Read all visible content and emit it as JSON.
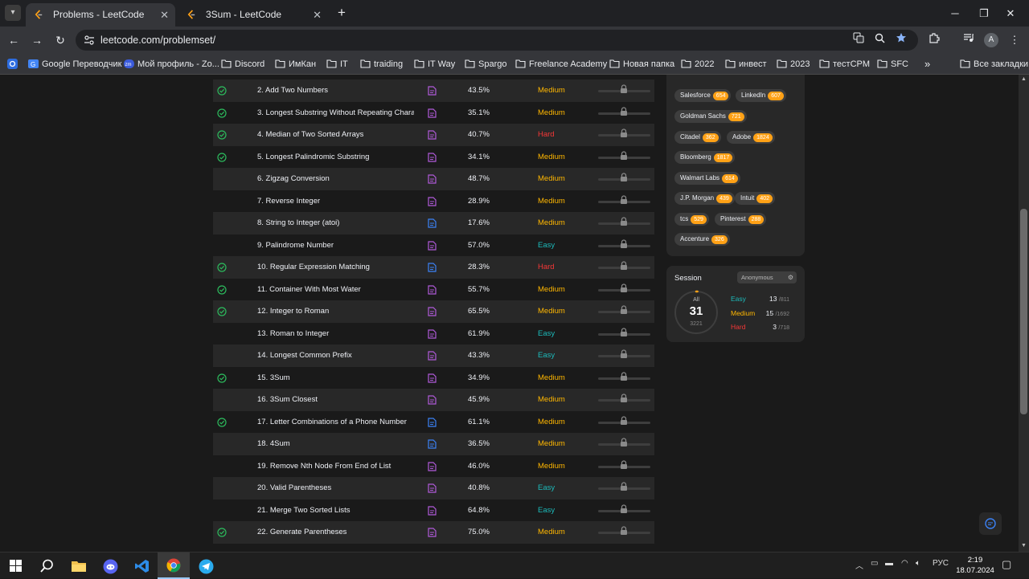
{
  "browser": {
    "tabs": [
      {
        "title": "Problems - LeetCode",
        "active": true
      },
      {
        "title": "3Sum - LeetCode",
        "active": false
      }
    ],
    "url": "leetcode.com/problemset/",
    "profile_initial": "A",
    "bookmarks": [
      "Google Переводчик",
      "Мой профиль - Zo...",
      "Discord",
      "ИмКан",
      "IT",
      "traiding",
      "IT Way",
      "Spargo",
      "Freelance Academy",
      "Новая папка",
      "2022",
      "инвест",
      "2023",
      "тестCPM",
      "SFC"
    ],
    "more_bookmarks": "»",
    "all_bookmarks": "Все закладки"
  },
  "problems": [
    {
      "title": "2. Add Two Numbers",
      "acceptance": "43.5%",
      "difficulty": "Medium",
      "solved": true
    },
    {
      "title": "3. Longest Substring Without Repeating Chara...",
      "acceptance": "35.1%",
      "difficulty": "Medium",
      "solved": true
    },
    {
      "title": "4. Median of Two Sorted Arrays",
      "acceptance": "40.7%",
      "difficulty": "Hard",
      "solved": true
    },
    {
      "title": "5. Longest Palindromic Substring",
      "acceptance": "34.1%",
      "difficulty": "Medium",
      "solved": true
    },
    {
      "title": "6. Zigzag Conversion",
      "acceptance": "48.7%",
      "difficulty": "Medium",
      "solved": false
    },
    {
      "title": "7. Reverse Integer",
      "acceptance": "28.9%",
      "difficulty": "Medium",
      "solved": false
    },
    {
      "title": "8. String to Integer (atoi)",
      "acceptance": "17.6%",
      "difficulty": "Medium",
      "solved": false
    },
    {
      "title": "9. Palindrome Number",
      "acceptance": "57.0%",
      "difficulty": "Easy",
      "solved": false
    },
    {
      "title": "10. Regular Expression Matching",
      "acceptance": "28.3%",
      "difficulty": "Hard",
      "solved": true
    },
    {
      "title": "11. Container With Most Water",
      "acceptance": "55.7%",
      "difficulty": "Medium",
      "solved": true
    },
    {
      "title": "12. Integer to Roman",
      "acceptance": "65.5%",
      "difficulty": "Medium",
      "solved": true
    },
    {
      "title": "13. Roman to Integer",
      "acceptance": "61.9%",
      "difficulty": "Easy",
      "solved": false
    },
    {
      "title": "14. Longest Common Prefix",
      "acceptance": "43.3%",
      "difficulty": "Easy",
      "solved": false
    },
    {
      "title": "15. 3Sum",
      "acceptance": "34.9%",
      "difficulty": "Medium",
      "solved": true
    },
    {
      "title": "16. 3Sum Closest",
      "acceptance": "45.9%",
      "difficulty": "Medium",
      "solved": false
    },
    {
      "title": "17. Letter Combinations of a Phone Number",
      "acceptance": "61.1%",
      "difficulty": "Medium",
      "solved": true
    },
    {
      "title": "18. 4Sum",
      "acceptance": "36.5%",
      "difficulty": "Medium",
      "solved": false
    },
    {
      "title": "19. Remove Nth Node From End of List",
      "acceptance": "46.0%",
      "difficulty": "Medium",
      "solved": false
    },
    {
      "title": "20. Valid Parentheses",
      "acceptance": "40.8%",
      "difficulty": "Easy",
      "solved": false
    },
    {
      "title": "21. Merge Two Sorted Lists",
      "acceptance": "64.8%",
      "difficulty": "Easy",
      "solved": false
    },
    {
      "title": "22. Generate Parentheses",
      "acceptance": "75.0%",
      "difficulty": "Medium",
      "solved": true
    }
  ],
  "companies": [
    {
      "name": "Salesforce",
      "count": "654"
    },
    {
      "name": "LinkedIn",
      "count": "607"
    },
    {
      "name": "Goldman Sachs",
      "count": "721"
    },
    {
      "name": "Citadel",
      "count": "362"
    },
    {
      "name": "Adobe",
      "count": "1824"
    },
    {
      "name": "Bloomberg",
      "count": "1817"
    },
    {
      "name": "Walmart Labs",
      "count": "614"
    },
    {
      "name": "J.P. Morgan",
      "count": "439"
    },
    {
      "name": "Intuit",
      "count": "402"
    },
    {
      "name": "tcs",
      "count": "529"
    },
    {
      "name": "Pinterest",
      "count": "288"
    },
    {
      "name": "Accenture",
      "count": "326"
    }
  ],
  "session": {
    "title": "Session",
    "mode": "Anonymous",
    "all_label": "All",
    "solved": "31",
    "total": "3221",
    "easy": {
      "label": "Easy",
      "solved": "13",
      "total": "/811"
    },
    "medium": {
      "label": "Medium",
      "solved": "15",
      "total": "/1692"
    },
    "hard": {
      "label": "Hard",
      "solved": "3",
      "total": "/718"
    }
  },
  "taskbar": {
    "language": "РУС",
    "time": "2:19",
    "date": "18.07.2024"
  },
  "colors": {
    "easy": "#1cbaba",
    "medium": "#ffb700",
    "hard": "#f63737",
    "accent": "#ffa116"
  }
}
